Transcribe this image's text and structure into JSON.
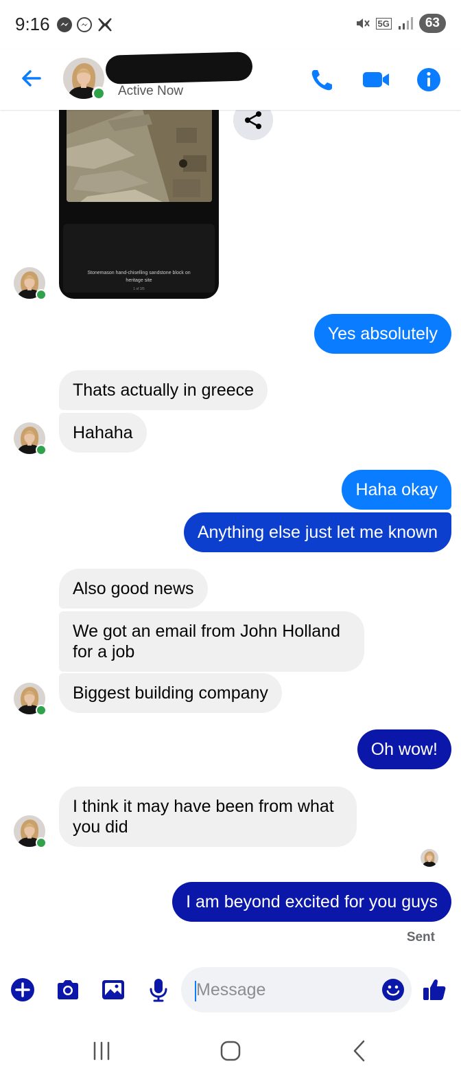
{
  "status_bar": {
    "time": "9:16",
    "battery": "63",
    "network": "5G"
  },
  "header": {
    "status": "Active Now"
  },
  "shared_image": {
    "caption": "Stonemason hand-chiselling sandstone block on heritage site",
    "counter": "1 of 3/5"
  },
  "messages": [
    {
      "id": "m1",
      "direction": "out",
      "text": "Yes absolutely"
    },
    {
      "id": "m2",
      "direction": "in",
      "text": "Thats actually in greece"
    },
    {
      "id": "m3",
      "direction": "in",
      "text": "Hahaha"
    },
    {
      "id": "m4",
      "direction": "out",
      "text": "Haha okay"
    },
    {
      "id": "m5",
      "direction": "out",
      "text": "Anything else just let me known"
    },
    {
      "id": "m6",
      "direction": "in",
      "text": "Also good news"
    },
    {
      "id": "m7",
      "direction": "in",
      "text": "We got an email from John Holland for a job"
    },
    {
      "id": "m8",
      "direction": "in",
      "text": "Biggest building company"
    },
    {
      "id": "m9",
      "direction": "out",
      "text": "Oh wow!"
    },
    {
      "id": "m10",
      "direction": "in",
      "text": "I think it may have been from what you did"
    },
    {
      "id": "m11",
      "direction": "out",
      "text": "I am beyond excited for you guys"
    }
  ],
  "delivery_status": "Sent",
  "composer": {
    "placeholder": "Message"
  },
  "colors": {
    "accent": "#0a7cff",
    "online": "#31a24c",
    "incoming_bubble": "#f0f0f0",
    "outgoing_deep": "#0b17a8"
  },
  "icons": [
    "messenger-icon",
    "messenger-outline-icon",
    "x-logo-icon",
    "mute-icon",
    "signal-icon",
    "back-arrow-icon",
    "phone-icon",
    "video-camera-icon",
    "info-icon",
    "share-icon",
    "plus-icon",
    "camera-icon",
    "gallery-icon",
    "microphone-icon",
    "emoji-icon",
    "thumbs-up-icon",
    "recents-icon",
    "home-icon",
    "nav-back-icon"
  ]
}
